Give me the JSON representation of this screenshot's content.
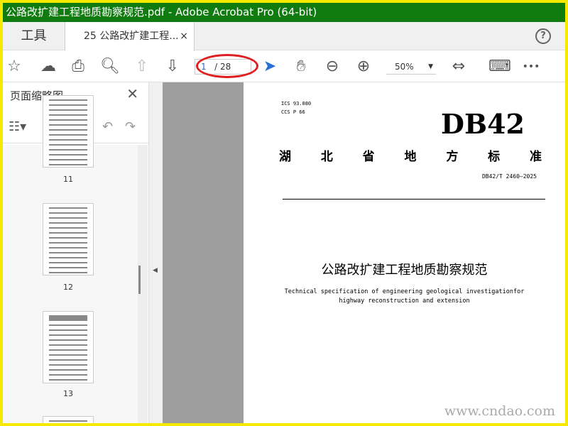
{
  "window": {
    "title": "公路改扩建工程地质勘察规范.pdf - Adobe Acrobat Pro (64-bit)",
    "accent": "#107c10"
  },
  "tabs": {
    "tools": "工具",
    "document": "25 公路改扩建工程...",
    "close": "×",
    "help": "?"
  },
  "toolbar": {
    "page_current": "1",
    "page_total": "/ 28",
    "zoom": "50%",
    "more": "•••"
  },
  "sidebar": {
    "title": "页面缩略图",
    "close": "✕",
    "thumbnails": [
      {
        "page": "11"
      },
      {
        "page": "12"
      },
      {
        "page": "13"
      }
    ]
  },
  "document": {
    "ics": "ICS  93.080",
    "ccs": "CCS  P 66",
    "code_big": "DB42",
    "provincial": [
      "湖",
      "北",
      "省",
      "地",
      "方",
      "标",
      "准"
    ],
    "std_number": "DB42/T 2460—2025",
    "title_cn": "公路改扩建工程地质勘察规范",
    "title_en_1": "Technical specification of engineering geological investigationfor",
    "title_en_2": "highway reconstruction and extension"
  },
  "watermark": "www.cndao.com"
}
